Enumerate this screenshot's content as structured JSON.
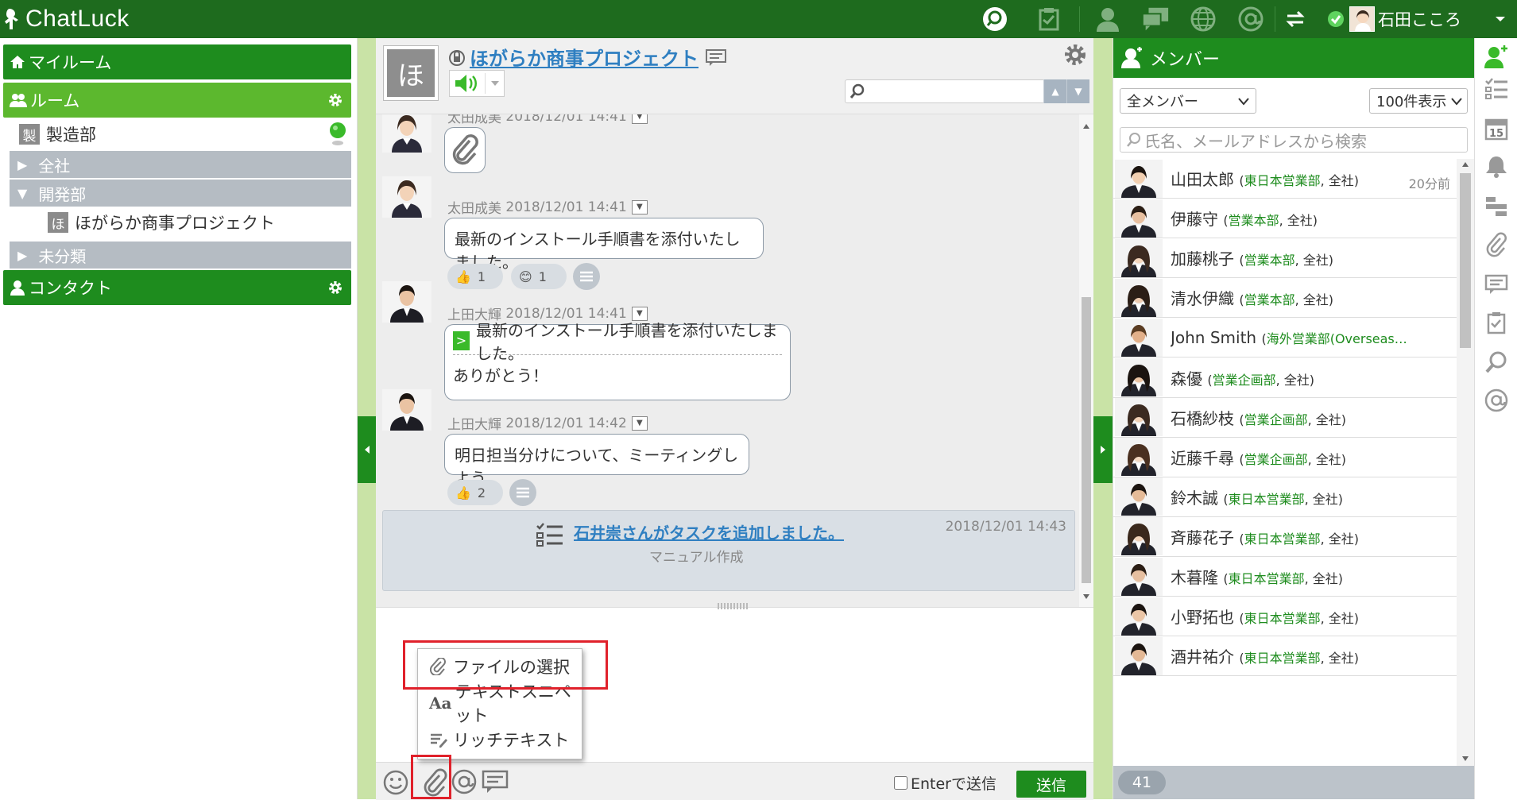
{
  "app": {
    "name": "ChatLuck",
    "user_name": "石田こころ"
  },
  "sidebar": {
    "myroom": "マイルーム",
    "rooms": "ルーム",
    "room_seizo": {
      "badge": "製",
      "label": "製造部"
    },
    "groups": [
      {
        "label": "全社",
        "expanded": false
      },
      {
        "label": "開発部",
        "expanded": true
      },
      {
        "label": "未分類",
        "expanded": false
      }
    ],
    "room_hogaraka": {
      "badge": "ほ",
      "label": "ほがらか商事プロジェクト"
    },
    "contacts": "コンタクト"
  },
  "chat": {
    "room_badge": "ほ",
    "room_title": "ほがらか商事プロジェクト",
    "messages": [
      {
        "author": "太田成美",
        "time": "2018/12/01 14:41"
      },
      {
        "author": "太田成美",
        "time": "2018/12/01 14:41",
        "text": "最新のインストール手順書を添付いたしました。",
        "reactions": [
          {
            "emoji": "thumbs-up",
            "count": "1"
          },
          {
            "emoji": "smile",
            "count": "1"
          }
        ]
      },
      {
        "author": "上田大輝",
        "time": "2018/12/01 14:41",
        "quote": "最新のインストール手順書を添付いたしました。",
        "text": "ありがとう！"
      },
      {
        "author": "上田大輝",
        "time": "2018/12/01 14:42",
        "text": "明日担当分けについて、ミーティングしよう。",
        "reactions": [
          {
            "emoji": "thumbs-up",
            "count": "2"
          }
        ]
      }
    ],
    "task": {
      "title": "石井崇さんがタスクを追加しました。",
      "time": "2018/12/01 14:43",
      "subtitle": "マニュアル作成"
    },
    "attach_menu": [
      "ファイルの選択",
      "テキストスニペット",
      "リッチテキスト"
    ],
    "enter_to_send": "Enterで送信",
    "send": "送信"
  },
  "members": {
    "title": "メンバー",
    "filter": "全メンバー",
    "page_size": "100件表示",
    "search_placeholder": "氏名、メールアドレスから検索",
    "list": [
      {
        "name": "山田太郎",
        "dept": "東日本営業部",
        "org": ", 全社)",
        "time": "20分前"
      },
      {
        "name": "伊藤守",
        "dept": "営業本部",
        "org": ", 全社)"
      },
      {
        "name": "加藤桃子",
        "dept": "営業本部",
        "org": ", 全社)"
      },
      {
        "name": "清水伊織",
        "dept": "営業本部",
        "org": ", 全社)"
      },
      {
        "name": "John Smith",
        "dept": "海外営業部(Overseas…",
        "org": ""
      },
      {
        "name": "森優",
        "dept": "営業企画部",
        "org": ", 全社)"
      },
      {
        "name": "石橋紗枝",
        "dept": "営業企画部",
        "org": ", 全社)"
      },
      {
        "name": "近藤千尋",
        "dept": "営業企画部",
        "org": ", 全社)"
      },
      {
        "name": "鈴木誠",
        "dept": "東日本営業部",
        "org": ", 全社)"
      },
      {
        "name": "斉藤花子",
        "dept": "東日本営業部",
        "org": ", 全社)"
      },
      {
        "name": "木暮隆",
        "dept": "東日本営業部",
        "org": ", 全社)"
      },
      {
        "name": "小野拓也",
        "dept": "東日本営業部",
        "org": ", 全社)"
      },
      {
        "name": "酒井祐介",
        "dept": "東日本営業部",
        "org": ", 全社)"
      }
    ],
    "count": "41"
  },
  "colors": {
    "brand_dark": "#1e6b1e",
    "brand": "#1e8c1e",
    "brand_light": "#5cb82e",
    "link": "#2f7fc1",
    "highlight": "#e0212b"
  }
}
